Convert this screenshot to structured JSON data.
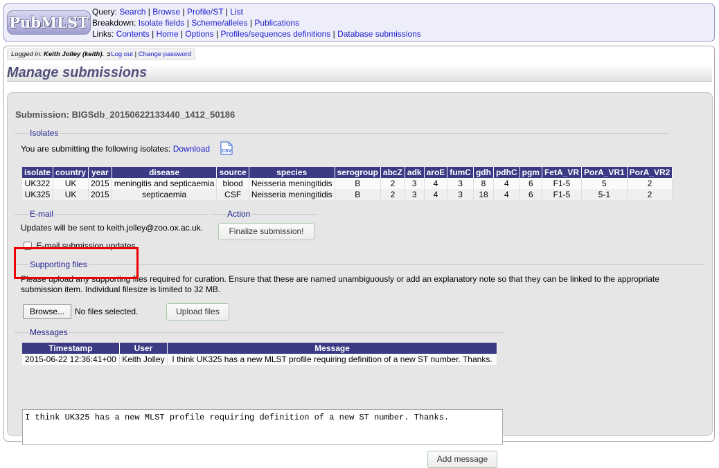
{
  "header": {
    "logo_text": "PubMLST",
    "query_label": "Query:",
    "query_links": [
      "Search",
      "Browse",
      "Profile/ST",
      "List"
    ],
    "breakdown_label": "Breakdown:",
    "breakdown_links": [
      "Isolate fields",
      "Scheme/alleles",
      "Publications"
    ],
    "links_label": "Links:",
    "links": [
      "Contents",
      "Home",
      "Options",
      "Profiles/sequences definitions",
      "Database submissions"
    ]
  },
  "login": {
    "logged_in_label": "Logged in:",
    "user": "Keith Jolley (keith).",
    "logout": "Log out",
    "change_password": "Change password"
  },
  "page_title": "Manage submissions",
  "submission": {
    "id_text": "Submission: BIGSdb_20150622133440_1412_50186"
  },
  "isolates": {
    "legend": "Isolates",
    "intro": "You are submitting the following isolates:",
    "download": "Download",
    "csv_icon_label": "CSV",
    "columns": [
      "isolate",
      "country",
      "year",
      "disease",
      "source",
      "species",
      "serogroup",
      "abcZ",
      "adk",
      "aroE",
      "fumC",
      "gdh",
      "pdhC",
      "pgm",
      "FetA_VR",
      "PorA_VR1",
      "PorA_VR2"
    ],
    "rows": [
      [
        "UK322",
        "UK",
        "2015",
        "meningitis and septicaemia",
        "blood",
        "Neisseria meningitidis",
        "B",
        "2",
        "3",
        "4",
        "3",
        "8",
        "4",
        "6",
        "F1-5",
        "5",
        "2"
      ],
      [
        "UK325",
        "UK",
        "2015",
        "septicaemia",
        "CSF",
        "Neisseria meningitidis",
        "B",
        "2",
        "3",
        "4",
        "3",
        "18",
        "4",
        "6",
        "F1-5",
        "5-1",
        "2"
      ]
    ]
  },
  "email": {
    "legend": "E-mail",
    "text": "Updates will be sent to keith.jolley@zoo.ox.ac.uk.",
    "checkbox_label": "E-mail submission updates",
    "checked": false
  },
  "action": {
    "legend": "Action",
    "finalize": "Finalize submission!"
  },
  "supporting": {
    "legend": "Supporting files",
    "text1": "Please upload any supporting files required for curation. Ensure that these are named unambiguously or add an explanatory note so that they can be linked to the appropriate",
    "text2": "submission item. Individual filesize is limited to 32 MB.",
    "browse": "Browse...",
    "no_files": "No files selected.",
    "upload": "Upload files"
  },
  "messages": {
    "legend": "Messages",
    "columns": [
      "Timestamp",
      "User",
      "Message"
    ],
    "rows": [
      [
        "2015-06-22 12:36:41+00",
        "Keith Jolley",
        "I think UK325 has a new MLST profile requiring definition of a new ST number. Thanks."
      ]
    ],
    "textarea_value": "I think UK325 has a new MLST profile requiring definition of a new ST number.  Thanks.",
    "add_button": "Add message"
  },
  "colors": {
    "table_header": "#3a3a85",
    "legend_text": "#1c1c8c",
    "link": "#1a1acc",
    "highlight_box": "#e00000"
  }
}
